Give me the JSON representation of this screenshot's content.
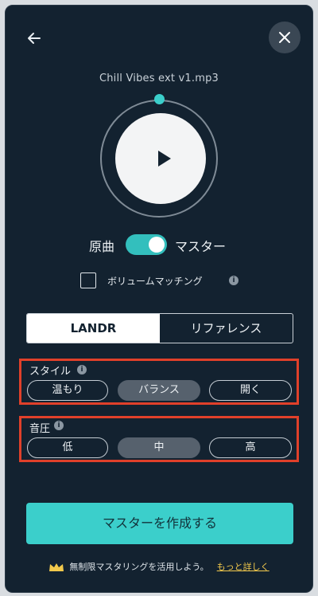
{
  "player": {
    "filename": "Chill Vibes ext v1.mp3",
    "progress": 0,
    "accent_color": "#3bcfcb"
  },
  "icons": {
    "back": "arrow-left-icon",
    "close": "close-icon",
    "play": "play-icon",
    "info": "info-icon",
    "crown": "crown-icon"
  },
  "toggle": {
    "left_label": "原曲",
    "right_label": "マスター",
    "state": "master"
  },
  "volume_matching": {
    "label": "ボリュームマッチング",
    "checked": false,
    "info_glyph": "i"
  },
  "mode_tabs": {
    "items": [
      {
        "label": "LANDR",
        "active": true
      },
      {
        "label": "リファレンス",
        "active": false
      }
    ]
  },
  "style": {
    "title": "スタイル",
    "options": [
      "温もり",
      "バランス",
      "開く"
    ],
    "selected": "バランス"
  },
  "loudness": {
    "title": "音圧",
    "options": [
      "低",
      "中",
      "高"
    ],
    "selected": "中"
  },
  "cta": {
    "label": "マスターを作成する"
  },
  "promo": {
    "text": "無制限マスタリングを活用しよう。",
    "link": "もっと詳しく"
  }
}
